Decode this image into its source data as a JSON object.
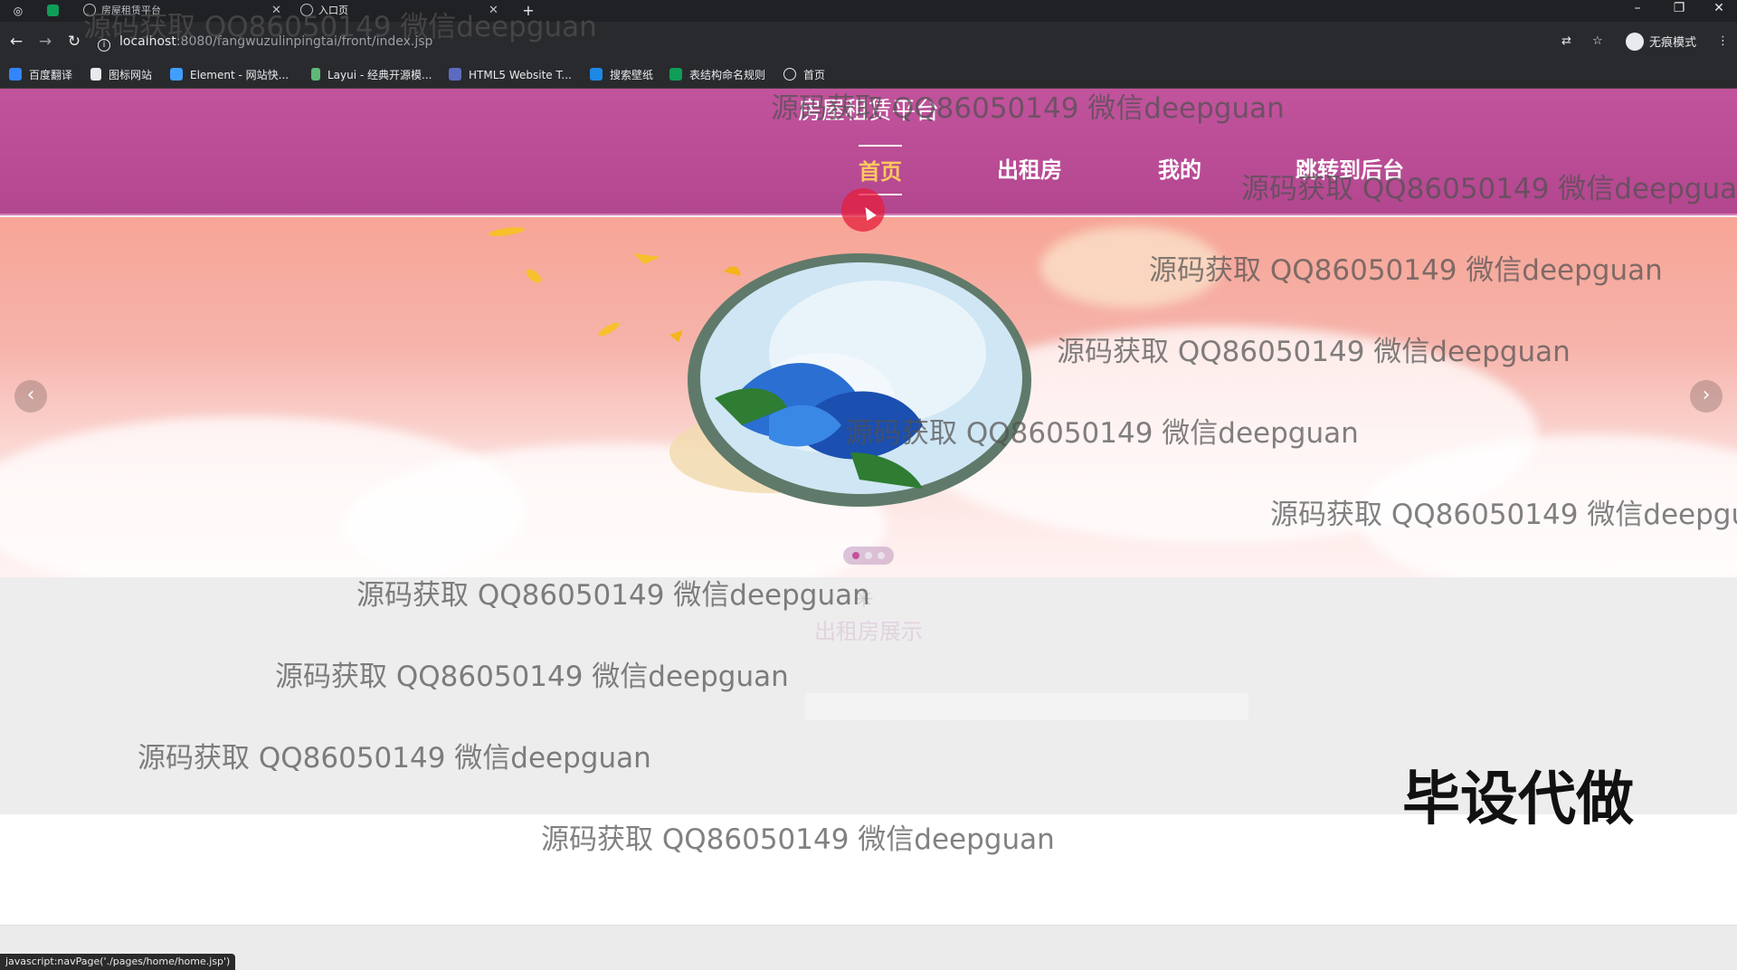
{
  "browser": {
    "tabs": [
      {
        "title": "房屋租赁平台"
      },
      {
        "title": "入口页"
      }
    ],
    "url_host": "localhost",
    "url_path": ":8080/fangwuzulinpingtai/front/index.jsp",
    "profile_label": "无痕模式",
    "bookmarks": [
      {
        "label": "百度翻译",
        "color": "#3385ff"
      },
      {
        "label": "图标网站",
        "color": "#e8eaed"
      },
      {
        "label": "Element - 网站快...",
        "color": "#409eff"
      },
      {
        "label": "Layui - 经典开源模...",
        "color": "#5fb878"
      },
      {
        "label": "HTML5 Website T...",
        "color": "#5c6bc0"
      },
      {
        "label": "搜索壁纸",
        "color": "#1e88e5"
      },
      {
        "label": "表结构命名规则",
        "color": "#0f9d58"
      },
      {
        "label": "首页",
        "color": "#e8eaed"
      }
    ],
    "status_url": "javascript:navPage('./pages/home/home.jsp')"
  },
  "site": {
    "title": "房屋租赁平台",
    "nav": [
      {
        "label": "首页",
        "active": true
      },
      {
        "label": "出租房",
        "active": false
      },
      {
        "label": "我的",
        "active": false
      },
      {
        "label": "跳转到后台",
        "active": false
      }
    ],
    "section_title": "出租房展示",
    "carousel_page": 1,
    "carousel_total": 3
  },
  "overlay": {
    "watermark": "源码获取 QQ86050149 微信deepguan",
    "watermark_clipped": "源码获取 QQ86050149 微信deepgua",
    "stamp": "毕设代做"
  },
  "colors": {
    "header": "#c2539d",
    "nav_active": "#ffc95e",
    "browser_dark": "#292a2d"
  }
}
